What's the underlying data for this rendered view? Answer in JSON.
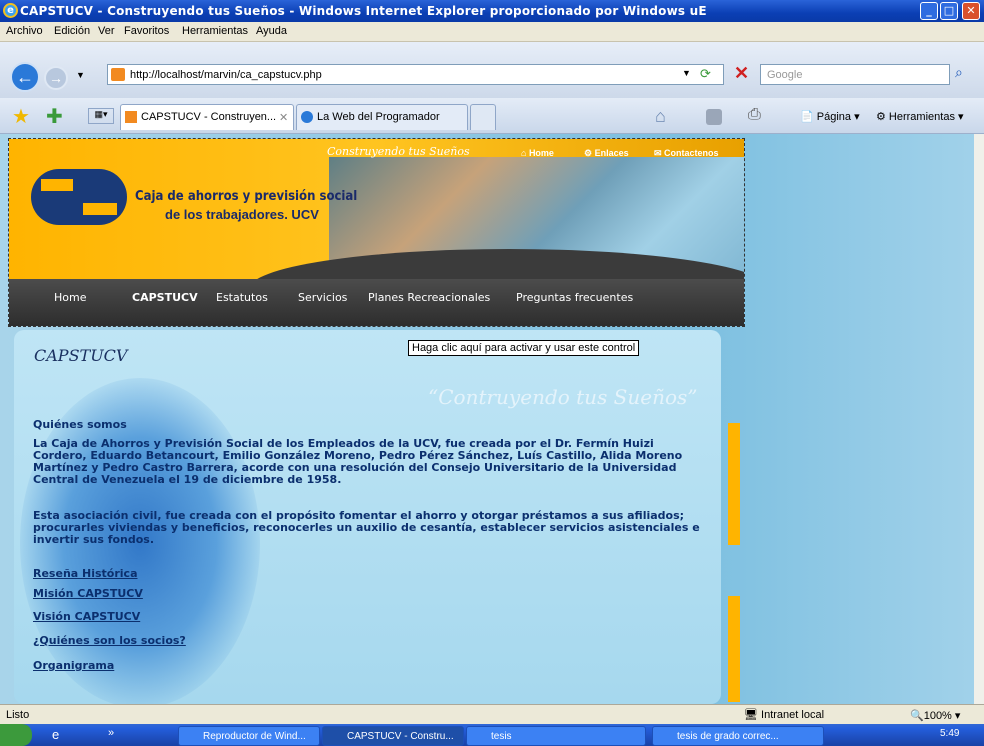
{
  "window": {
    "title": "CAPSTUCV - Construyendo tus Sueños - Windows Internet Explorer proporcionado por Windows uE"
  },
  "menu": [
    "Archivo",
    "Edición",
    "Ver",
    "Favoritos",
    "Herramientas",
    "Ayuda"
  ],
  "address": {
    "url": "http://localhost/marvin/ca_capstucv.php",
    "search_placeholder": "Google"
  },
  "tabs": [
    "CAPSTUCV - Construyen...",
    "La Web del Programador"
  ],
  "commandbar": {
    "page": "Página",
    "tools": "Herramientas"
  },
  "site": {
    "slogan_top": "Construyendo tus Sueños",
    "top_links": [
      "Home",
      "Enlaces",
      "Contactenos"
    ],
    "brand_line1": "Caja de ahorros y previsión social",
    "brand_line2": "de los trabajadores. UCV",
    "nav": [
      "Home",
      "CAPSTUCV",
      "Estatutos",
      "Servicios",
      "Planes Recreacionales",
      "Preguntas frecuentes"
    ]
  },
  "page": {
    "title": "CAPSTUCV",
    "activex_tip": "Haga clic aquí para activar y usar este control",
    "slogan": "“Contruyendo tus Sueños”",
    "section": "Quiénes somos",
    "para1": [
      "La Caja de Ahorros y Previsión Social de los Empleados de la UCV, fue creada por el Dr. Fermín Huizi",
      "Cordero, Eduardo Betancourt, Emilio González Moreno, Pedro Pérez Sánchez, Luís Castillo, Alida Moreno",
      "Martínez y Pedro Castro Barrera, acorde con una resolución del Consejo Universitario de la Universidad",
      "Central de Venezuela el 19 de diciembre de 1958."
    ],
    "para2": [
      "Esta asociación civil, fue creada con el propósito fomentar el ahorro y otorgar préstamos a sus afiliados;",
      "procurarles viviendas y beneficios, reconocerles un auxilio de cesantía, establecer servicios asistenciales e",
      "invertir sus fondos."
    ],
    "links": [
      "Reseña Histórica",
      "Misión CAPSTUCV",
      "Visión CAPSTUCV",
      "¿Quiénes son los socios?",
      "Organigrama"
    ]
  },
  "status": {
    "text": "Listo",
    "zone": "Intranet local",
    "zoom": "100%"
  },
  "taskbar": {
    "items": [
      "Reproductor de Wind...",
      "CAPSTUCV - Constru...",
      "tesis",
      "tesis de grado correc..."
    ],
    "clock": "5:49"
  },
  "colors": {
    "accent": "#0b2f6e",
    "banner": "#ffb400"
  }
}
